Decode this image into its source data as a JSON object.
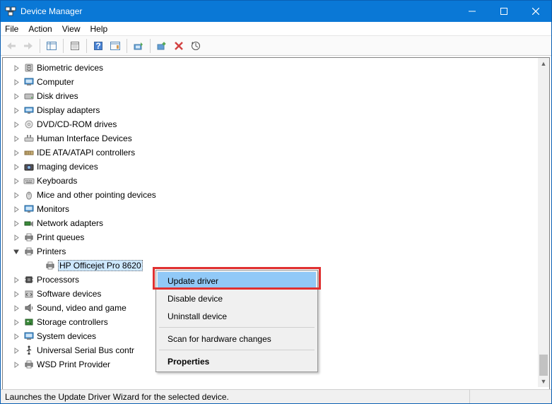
{
  "window": {
    "title": "Device Manager"
  },
  "menu": {
    "file": "File",
    "action": "Action",
    "view": "View",
    "help": "Help"
  },
  "tree": {
    "items": [
      {
        "label": "Biometric devices",
        "expanded": false
      },
      {
        "label": "Computer",
        "expanded": false
      },
      {
        "label": "Disk drives",
        "expanded": false
      },
      {
        "label": "Display adapters",
        "expanded": false
      },
      {
        "label": "DVD/CD-ROM drives",
        "expanded": false
      },
      {
        "label": "Human Interface Devices",
        "expanded": false
      },
      {
        "label": "IDE ATA/ATAPI controllers",
        "expanded": false
      },
      {
        "label": "Imaging devices",
        "expanded": false
      },
      {
        "label": "Keyboards",
        "expanded": false
      },
      {
        "label": "Mice and other pointing devices",
        "expanded": false
      },
      {
        "label": "Monitors",
        "expanded": false
      },
      {
        "label": "Network adapters",
        "expanded": false
      },
      {
        "label": "Print queues",
        "expanded": false
      },
      {
        "label": "Printers",
        "expanded": true,
        "children": [
          {
            "label": "HP Officejet Pro 8620",
            "selected": true
          }
        ]
      },
      {
        "label": "Processors",
        "expanded": false
      },
      {
        "label": "Software devices",
        "expanded": false
      },
      {
        "label": "Sound, video and game",
        "expanded": false
      },
      {
        "label": "Storage controllers",
        "expanded": false
      },
      {
        "label": "System devices",
        "expanded": false
      },
      {
        "label": "Universal Serial Bus contr",
        "expanded": false
      },
      {
        "label": "WSD Print Provider",
        "expanded": false
      }
    ]
  },
  "context_menu": {
    "update": "Update driver",
    "disable": "Disable device",
    "uninstall": "Uninstall device",
    "scan": "Scan for hardware changes",
    "properties": "Properties"
  },
  "statusbar": {
    "text": "Launches the Update Driver Wizard for the selected device."
  }
}
